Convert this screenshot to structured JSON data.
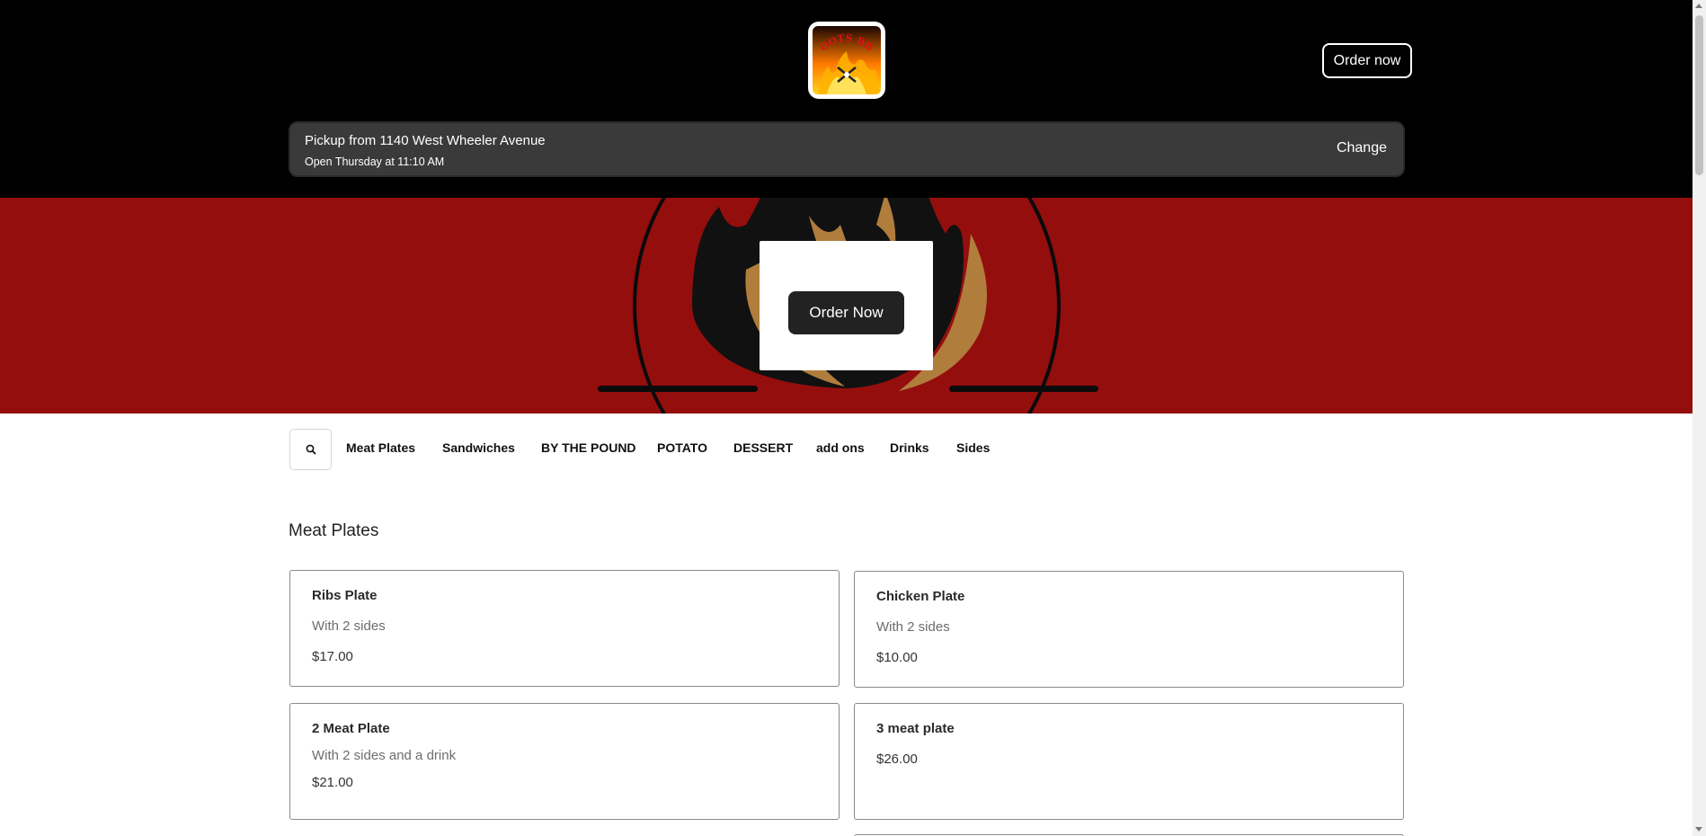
{
  "header": {
    "logo_text": "BOOTS BBQ",
    "order_now_label": "Order now",
    "pickup": {
      "title": "Pickup from 1140 West Wheeler Avenue",
      "hours": "Open Thursday at 11:10 AM",
      "change_label": "Change"
    }
  },
  "hero": {
    "order_now_label": "Order Now",
    "background_color": "#940e0e"
  },
  "nav": {
    "search_icon": "search-icon",
    "categories": [
      "Meat Plates",
      "Sandwiches",
      "BY THE POUND",
      "POTATO",
      "DESSERT",
      "add ons",
      "Drinks",
      "Sides"
    ]
  },
  "menu": {
    "section_title": "Meat Plates",
    "items": [
      {
        "name": "Ribs Plate",
        "description": "With 2 sides",
        "price": "$17.00"
      },
      {
        "name": "Chicken Plate",
        "description": "With 2 sides",
        "price": "$10.00"
      },
      {
        "name": "2 Meat Plate",
        "description": "With 2 sides and a drink",
        "price": "$21.00"
      },
      {
        "name": "3 meat plate",
        "description": "",
        "price": "$26.00"
      }
    ]
  }
}
